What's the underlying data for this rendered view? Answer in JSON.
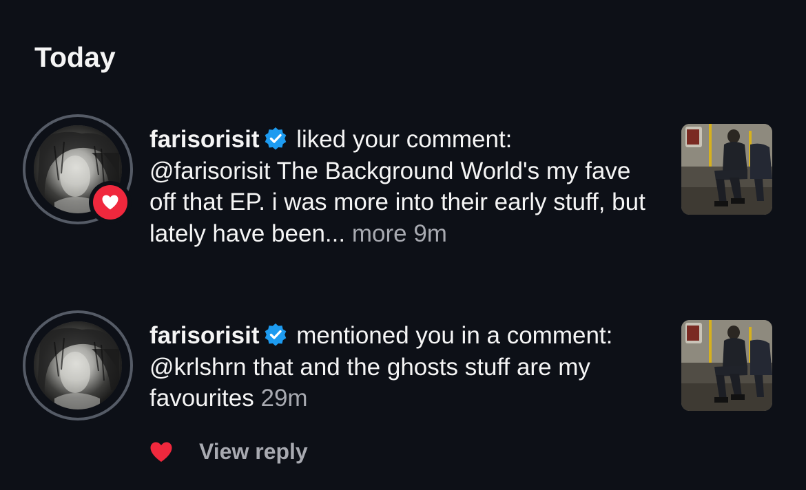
{
  "section": {
    "title": "Today"
  },
  "notifications": [
    {
      "username": "farisorisit",
      "verified": true,
      "badge_icon": "heart-icon",
      "action": "liked your comment:",
      "comment_text": "@farisorisit The Background World's my fave off that EP. i was more into their early stuff, but lately have been...",
      "more_label": "more",
      "time": "9m"
    },
    {
      "username": "farisorisit",
      "verified": true,
      "action": "mentioned you in a comment:",
      "comment_text": "@krlshrn that and the ghosts stuff are my favourites",
      "time": "29m"
    }
  ],
  "reply": {
    "heart_icon": "heart-icon",
    "view_reply_label": "View reply"
  },
  "colors": {
    "background": "#0d1017",
    "text": "#f5f5f5",
    "muted": "#a8aab1",
    "verified_blue": "#1d9bf0",
    "like_red": "#f0283d",
    "avatar_ring": "#555b66"
  }
}
